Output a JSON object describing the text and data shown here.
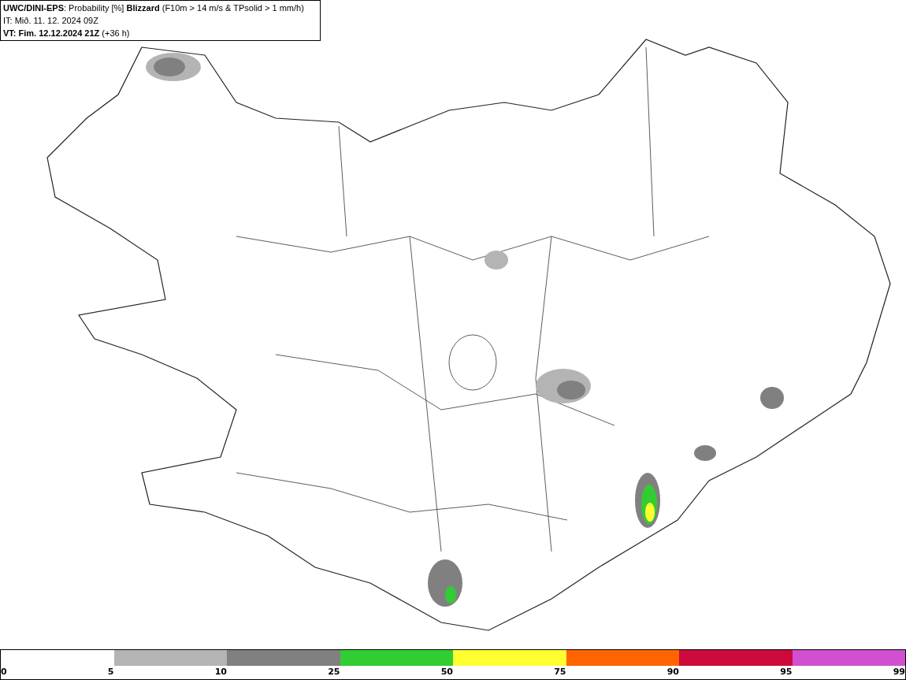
{
  "header": {
    "lines": [
      "**UWC/DINI-EPS**: Probability [%] **Blizzard** (F10m > 14 m/s & TPsolid > 1 mm/h)",
      "IT: Mið. 11. 12. 2024 09Z",
      "**VT: Fim. 12.12.2024 21Z** (+36 h)"
    ]
  },
  "legend": {
    "segments": [
      {
        "color": "#b4b4b4"
      },
      {
        "color": "#808080"
      },
      {
        "color": "#32cd32"
      },
      {
        "color": "#ffff32"
      },
      {
        "color": "#ff6400"
      },
      {
        "color": "#cd0a3c"
      },
      {
        "color": "#d050d0"
      }
    ],
    "labels": [
      "0",
      "5",
      "10",
      "25",
      "50",
      "75",
      "90",
      "95",
      "99"
    ]
  }
}
